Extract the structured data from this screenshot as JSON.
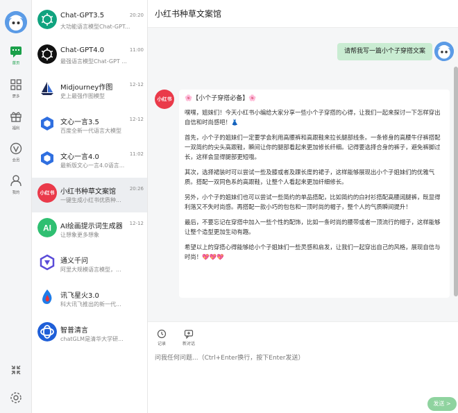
{
  "rail": {
    "items": [
      {
        "label": "首页"
      },
      {
        "label": "更多"
      },
      {
        "label": "福利"
      },
      {
        "label": "会员"
      },
      {
        "label": "我的"
      }
    ]
  },
  "conversations": [
    {
      "name": "Chat-GPT3.5",
      "time": "20:20",
      "sub": "大功能语言模型Chat-GPT..."
    },
    {
      "name": "Chat-GPT4.0",
      "time": "11:00",
      "sub": "最强语言模型Chat-GPT ..."
    },
    {
      "name": "Midjourney作图",
      "time": "12-12",
      "sub": "史上最强作图模型"
    },
    {
      "name": "文心一言3.5",
      "time": "12-12",
      "sub": "百度全新一代语言大模型"
    },
    {
      "name": "文心一言4.0",
      "time": "11:02",
      "sub": "最新版文心一言4.0语言..."
    },
    {
      "name": "小红书种草文案馆",
      "time": "20:26",
      "sub": "一键生成小红书优质种..."
    },
    {
      "name": "AI绘画提示词生成器",
      "time": "12-12",
      "sub": "让想象更多想象"
    },
    {
      "name": "通义千问",
      "time": "",
      "sub": "阿里大规模语言模型，..."
    },
    {
      "name": "讯飞星火3.0",
      "time": "",
      "sub": "科大讯飞推出的新一代..."
    },
    {
      "name": "智普清言",
      "time": "",
      "sub": "chatGLM是清华大学研..."
    }
  ],
  "chat": {
    "title": "小红书种草文案馆",
    "user_message": "请帮我写一篇小个子穿搭文案",
    "bot_avatar_text": "小红书",
    "bot_heading": "🌸【小个子穿搭必备】🌸",
    "bot_paragraphs": [
      "嘿嘿，姐妹们！今天小红书小编给大家分享一些小个子穿搭的心得，让我们一起来探讨一下怎样穿出自信和时尚感吧！👗",
      "首先，小个子的姐妹们一定要学会利用高腰裤和高跟鞋来拉长腿部线条。一条修身的高腰牛仔裤搭配一双简约的尖头高跟鞋，瞬间让你的腿部看起来更加修长纤细。记得要选择合身的裤子，避免裤脚过长，这样会显得腿部更短哦。",
      "其次，选择裙装时可以尝试一些及膝或者及踝长度的裙子，这样能够展现出小个子姐妹们的优雅气质。搭配一双同色系的高跟鞋，让整个人看起来更加纤细修长。",
      "另外，小个子的姐妹们也可以尝试一些简约的单品搭配，比如简约的白衬衫搭配高腰阔腿裤，既显得利落又不失时尚感。再搭配一款小巧的包包和一顶时尚的帽子，整个人的气质瞬间提升！",
      "最后，不要忘记在穿搭中加入一些个性的配饰，比如一条时尚的腰带或者一顶流行的帽子，这样能够让整个造型更加生动有趣。",
      "希望以上的穿搭心得能够给小个子姐妹们一些灵感和启发，让我们一起穿出自己的风格，展现自信与时尚！💖💖💖"
    ]
  },
  "input": {
    "tools": [
      {
        "label": "记录"
      },
      {
        "label": "新对话"
      }
    ],
    "placeholder": "问我任何问题...（Ctrl+Enter换行，按下Enter发送）",
    "send_label": "发送 >"
  },
  "colors": {
    "accent": "#1aa04a",
    "user_bubble": "#c9ecd2",
    "send_button": "#8fd39f",
    "xhs_red": "#ea3a4a"
  }
}
